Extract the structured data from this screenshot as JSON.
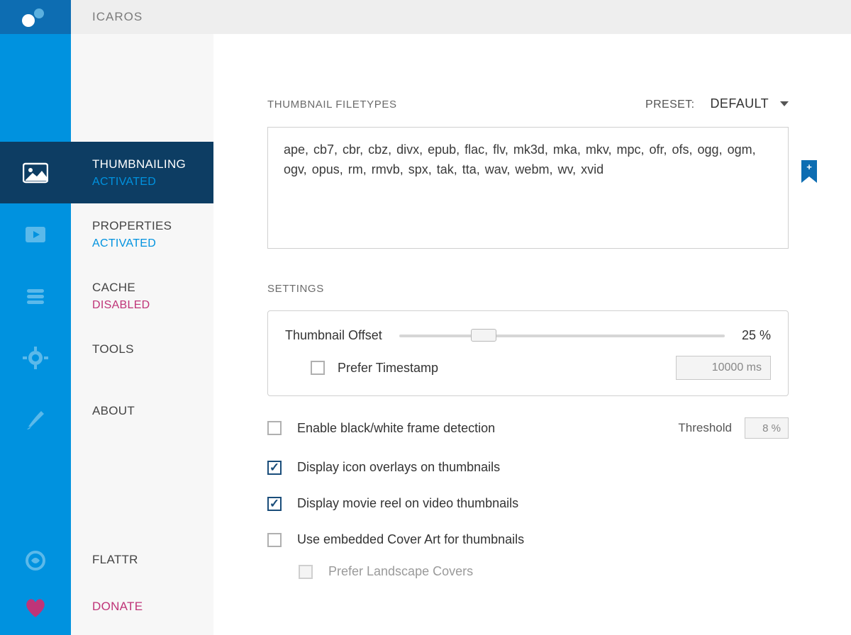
{
  "app_title": "ICAROS",
  "sidebar": {
    "items": [
      {
        "label": "THUMBNAILING",
        "status": "ACTIVATED"
      },
      {
        "label": "PROPERTIES",
        "status": "ACTIVATED"
      },
      {
        "label": "CACHE",
        "status": "DISABLED"
      },
      {
        "label": "TOOLS",
        "status": ""
      },
      {
        "label": "ABOUT",
        "status": ""
      }
    ],
    "bottom": [
      {
        "label": "FLATTR"
      },
      {
        "label": "DONATE"
      }
    ]
  },
  "filetypes": {
    "heading": "THUMBNAIL FILETYPES",
    "preset_label": "PRESET:",
    "preset_value": "DEFAULT",
    "list_text": "ape,  cb7,  cbr,  cbz,  divx,  epub,  flac,  flv,  mk3d,  mka,  mkv,  mpc,  ofr,  ofs,  ogg,  ogm,  ogv,  opus,  rm,  rmvb,  spx,  tak,  tta,  wav,  webm,  wv,  xvid",
    "bookmark_glyph": "+"
  },
  "settings": {
    "heading": "SETTINGS",
    "offset_label": "Thumbnail Offset",
    "offset_value": "25 %",
    "prefer_timestamp_label": "Prefer Timestamp",
    "prefer_timestamp_checked": false,
    "timestamp_value": "10000 ms",
    "options": [
      {
        "label": "Enable black/white frame detection",
        "checked": false,
        "threshold_label": "Threshold",
        "threshold_value": "8 %"
      },
      {
        "label": "Display icon overlays on thumbnails",
        "checked": true
      },
      {
        "label": "Display movie reel on video thumbnails",
        "checked": true
      },
      {
        "label": "Use embedded Cover Art for thumbnails",
        "checked": false
      },
      {
        "label": "Prefer Landscape Covers",
        "checked": false,
        "sub": true,
        "disabled": true
      }
    ]
  }
}
